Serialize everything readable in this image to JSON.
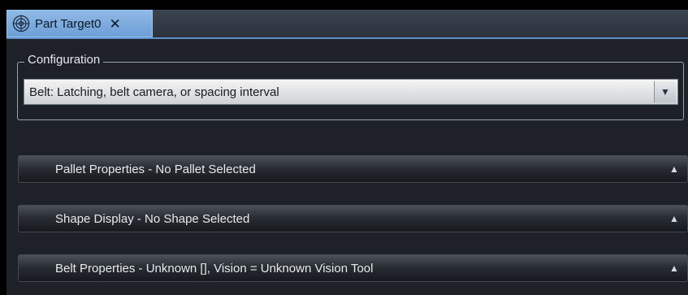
{
  "tab": {
    "label": "Part Target0",
    "icon": "target-icon",
    "close_glyph": "✕"
  },
  "configuration": {
    "legend": "Configuration",
    "selected_value": "Belt: Latching, belt camera, or spacing interval",
    "arrow_glyph": "▼"
  },
  "sections": [
    {
      "label": "Pallet Properties - No Pallet Selected",
      "arrow_glyph": "▲"
    },
    {
      "label": "Shape Display - No Shape Selected",
      "arrow_glyph": "▲"
    },
    {
      "label": "Belt Properties -  Unknown [], Vision = Unknown Vision Tool",
      "arrow_glyph": "▲"
    }
  ],
  "colors": {
    "tab_active": "#7fb0e3",
    "panel_bg": "#1e2228",
    "section_bar": "#2a2e34"
  }
}
